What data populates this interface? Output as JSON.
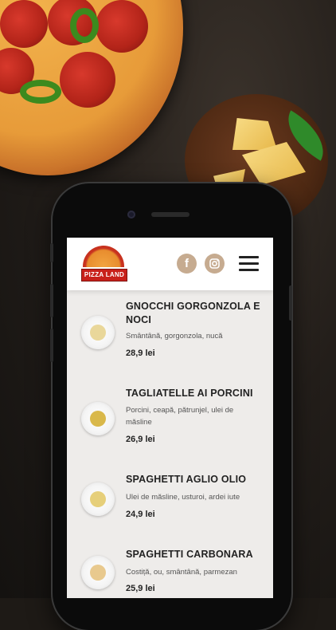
{
  "app": {
    "brand_logo_text": "PIZZA LAND",
    "social": [
      {
        "icon": "facebook-icon",
        "glyph": "f"
      },
      {
        "icon": "instagram-icon"
      }
    ],
    "menu_icon": "hamburger-menu-icon"
  },
  "menu": {
    "items": [
      {
        "name": "GNOCCHI GORGONZOLA E NOCI",
        "description": "Smântână, gorgonzola, nucă",
        "price": "28,9 lei",
        "food_color": "#e9d79a"
      },
      {
        "name": "TAGLIATELLE AI PORCINI",
        "description": "Porcini, ceapă, pătrunjel, ulei de măsline",
        "price": "26,9 lei",
        "food_color": "#d9b84a"
      },
      {
        "name": "SPAGHETTI AGLIO OLIO",
        "description": "Ulei de măsline, usturoi, ardei iute",
        "price": "24,9 lei",
        "food_color": "#e6cf7a"
      },
      {
        "name": "SPAGHETTI CARBONARA",
        "description": "Costiță, ou, smântână, parmezan",
        "price": "25,9 lei",
        "food_color": "#e8c98e"
      }
    ]
  }
}
